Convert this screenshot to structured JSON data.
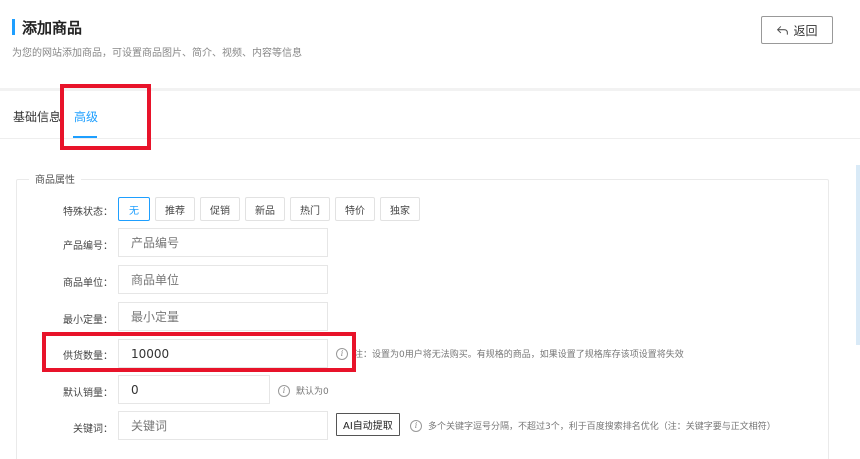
{
  "header": {
    "title": "添加商品",
    "subtitle": "为您的网站添加商品，可设置商品图片、简介、视频、内容等信息",
    "back_label": "返回"
  },
  "tabs": [
    {
      "label": "基础信息",
      "active": false
    },
    {
      "label": "高级",
      "active": true
    }
  ],
  "section": {
    "legend": "商品属性",
    "status": {
      "label": "特殊状态：",
      "options": [
        "无",
        "推荐",
        "促销",
        "新品",
        "热门",
        "特价",
        "独家"
      ],
      "selected": "无"
    },
    "fields": {
      "product_code": {
        "label": "产品编号：",
        "placeholder": "产品编号"
      },
      "unit": {
        "label": "商品单位：",
        "placeholder": "商品单位"
      },
      "min_qty": {
        "label": "最小定量：",
        "placeholder": "最小定量"
      },
      "supply_qty": {
        "label": "供货数量：",
        "value": "10000",
        "hint": "注：设置为0用户将无法购买。有规格的商品，如果设置了规格库存该项设置将失效"
      },
      "default_sales": {
        "label": "默认销量：",
        "value": "0",
        "hint": "默认为0"
      },
      "keywords": {
        "label": "关键词：",
        "placeholder": "关键词",
        "ai_button": "AI自动提取",
        "hint": "多个关键字逗号分隔，不超过3个，利于百度搜索排名优化（注：关键字要与正文相符）"
      }
    }
  },
  "hint_icon_glyph": "i",
  "colors": {
    "accent": "#1e9fff",
    "highlight": "#e8132a"
  }
}
